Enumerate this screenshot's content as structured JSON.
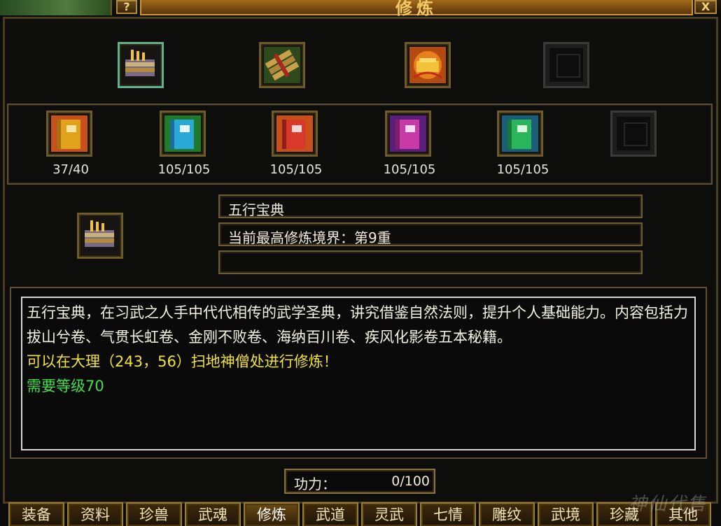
{
  "window": {
    "title": "修炼",
    "help_label": "?",
    "close_label": "X"
  },
  "top_icons": [
    {
      "name": "wuxing-baodian",
      "state": "selected"
    },
    {
      "name": "scroll-bundle",
      "state": "normal"
    },
    {
      "name": "golden-treasure",
      "state": "normal"
    },
    {
      "name": "empty",
      "state": "empty"
    }
  ],
  "books": [
    {
      "color": "#e0a21a",
      "count": "37/40"
    },
    {
      "color": "#2aa8d8",
      "count": "105/105"
    },
    {
      "color": "#d8392a",
      "count": "105/105"
    },
    {
      "color": "#c93aa6",
      "count": "105/105"
    },
    {
      "color": "#2bb55a",
      "count": "105/105"
    }
  ],
  "selected": {
    "name": "五行宝典",
    "realm": "当前最高修炼境界：第9重",
    "extra": ""
  },
  "description": {
    "line1": "五行宝典，在习武之人手中代代相传的武学圣典，讲究借鉴自然法则，提升个人基础能力。内容包括力拔山兮卷、气贯长虹卷、金刚不败卷、海纳百川卷、疾风化影卷五本秘籍。",
    "line2": "可以在大理（243，56）扫地神僧处进行修炼！",
    "line3": "需要等级70"
  },
  "power": {
    "label": "功力：",
    "value": "0/100"
  },
  "tabs": [
    {
      "label": "装备",
      "active": false
    },
    {
      "label": "资料",
      "active": false
    },
    {
      "label": "珍兽",
      "active": false
    },
    {
      "label": "武魂",
      "active": false
    },
    {
      "label": "修炼",
      "active": true
    },
    {
      "label": "武道",
      "active": false
    },
    {
      "label": "灵武",
      "active": false
    },
    {
      "label": "七情",
      "active": false
    },
    {
      "label": "雕纹",
      "active": false
    },
    {
      "label": "武境",
      "active": false
    },
    {
      "label": "珍藏",
      "active": false
    },
    {
      "label": "其他",
      "active": false
    }
  ],
  "watermark": "神仙代售"
}
